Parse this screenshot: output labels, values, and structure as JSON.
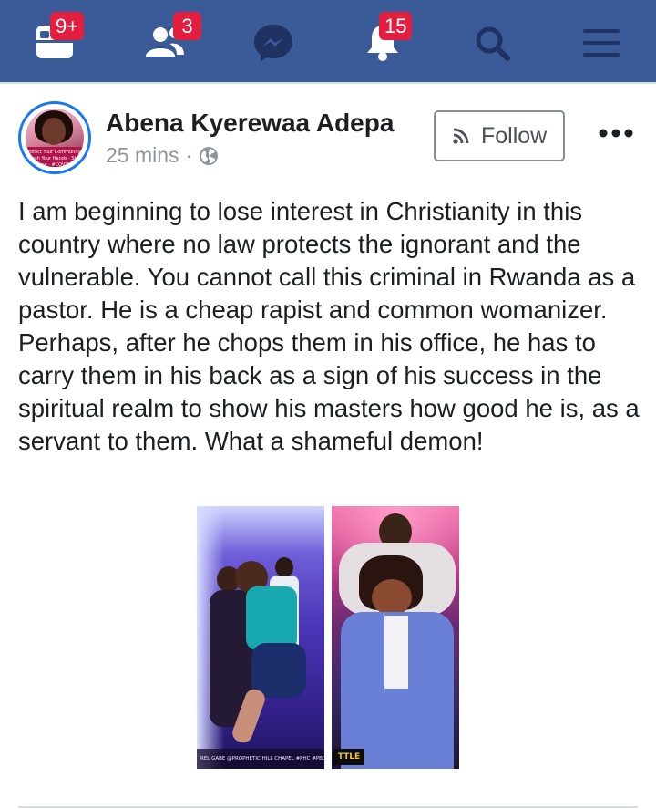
{
  "nav": {
    "items": [
      {
        "name": "news-feed-icon",
        "badge": "9+"
      },
      {
        "name": "friends-icon",
        "badge": "3"
      },
      {
        "name": "messenger-icon",
        "badge": ""
      },
      {
        "name": "notifications-icon",
        "badge": "15"
      },
      {
        "name": "search-icon",
        "badge": ""
      },
      {
        "name": "menu-icon",
        "badge": ""
      }
    ],
    "bar_color": "#3b5a98",
    "badge_color": "#e41e3f"
  },
  "post": {
    "author": "Abena Kyerewaa Adepa",
    "time": "25 mins",
    "separator": "·",
    "privacy_icon": "globe-icon",
    "follow_label": "Follow",
    "follow_icon": "rss-icon",
    "more_icon": "more-dots-icon",
    "avatar_caption": "Protect Your Community · Wash Your Hands · Stay Home · #COVID19",
    "text": "I am beginning to lose interest in Christianity in this country where no law protects the ignorant and the vulnerable. You cannot call this criminal in Rwanda as a pastor. He is a cheap rapist and common womanizer. Perhaps, after he chops them in his office, he has to carry them in his back as a sign of his success in the spiritual realm to show his masters how good he is, as a servant to them. What a shameful demon!",
    "photos": [
      {
        "caption": "REL GABE   @PROPHETIC HILL CHAPEL   #PHC   #PBD"
      },
      {
        "caption": "TTLE"
      }
    ]
  }
}
